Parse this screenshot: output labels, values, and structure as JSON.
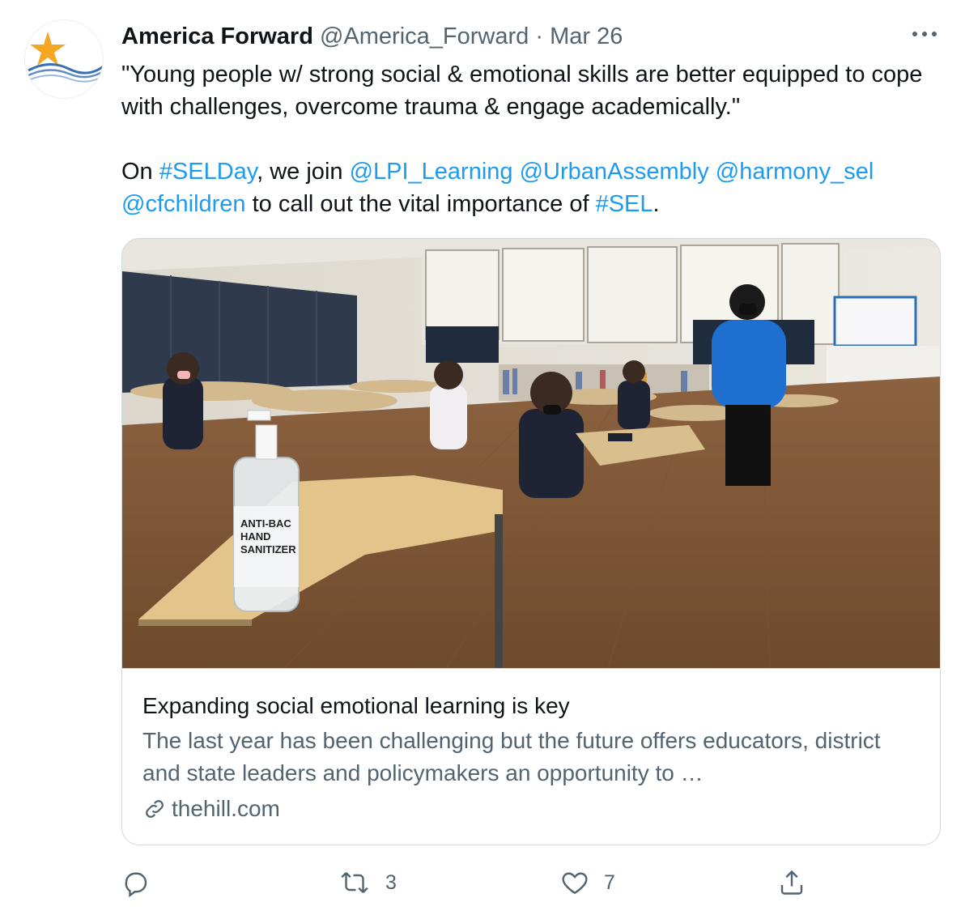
{
  "author": {
    "name": "America Forward",
    "handle": "@America_Forward",
    "separator": "·",
    "date": "Mar 26"
  },
  "tweet": {
    "line1": "\"Young people w/ strong social & emotional skills are better equipped to cope with challenges, overcome trauma & engage academically.\"",
    "p2_intro": "On ",
    "hashtag_selday": "#SELDay",
    "p2_mid": ", we join ",
    "mention_lpi": "@LPI_Learning",
    "mention_urban": "@UrbanAssembly",
    "mention_harmony": "@harmony_sel",
    "mention_cfc": "@cfchildren",
    "p2_end": " to call out the vital importance of ",
    "hashtag_sel": "#SEL",
    "p2_period": "."
  },
  "card": {
    "title": "Expanding social emotional learning is key",
    "description": "The last year has been challenging but the future offers educators, district and state leaders and policymakers an opportunity to …",
    "domain": "thehill.com",
    "image_text": {
      "bottle_line1": "ANTI-BAC",
      "bottle_line2": "HAND",
      "bottle_line3": "SANITIZER"
    }
  },
  "actions": {
    "reply_count": "",
    "retweet_count": "3",
    "like_count": "7"
  },
  "icons": {
    "more": "more-icon",
    "reply": "reply-icon",
    "retweet": "retweet-icon",
    "like": "like-icon",
    "share": "share-icon",
    "link": "link-icon"
  },
  "colors": {
    "link": "#1d9bf0",
    "secondary_text": "#536471",
    "border": "#cfd9de",
    "logo_star": "#f5a623",
    "logo_waves": "#3a6fb5"
  }
}
